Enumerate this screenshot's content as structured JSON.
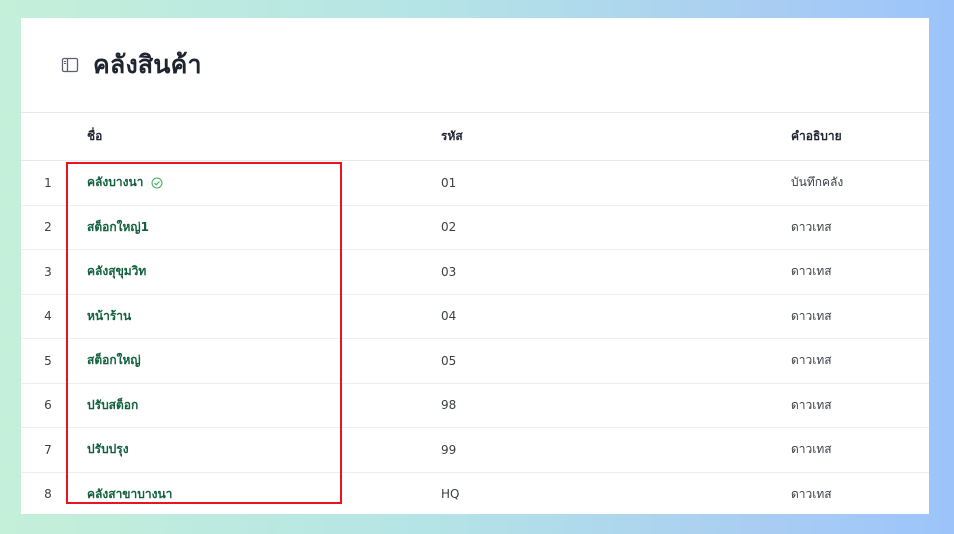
{
  "page": {
    "title": "คลังสินค้า",
    "title_icon": "sidebar-panel-icon"
  },
  "table": {
    "headers": {
      "name": "ชื่อ",
      "code": "รหัส",
      "description": "คำอธิบาย"
    },
    "rows": [
      {
        "index": "1",
        "name": "คลังบางนา",
        "code": "01",
        "description": "บันทึกคลัง",
        "verified": true
      },
      {
        "index": "2",
        "name": "สต็อกใหญ่1",
        "code": "02",
        "description": "ดาวเทส",
        "verified": false
      },
      {
        "index": "3",
        "name": "คลังสุขุมวิท",
        "code": "03",
        "description": "ดาวเทส",
        "verified": false
      },
      {
        "index": "4",
        "name": "หน้าร้าน",
        "code": "04",
        "description": "ดาวเทส",
        "verified": false
      },
      {
        "index": "5",
        "name": "สต็อกใหญ่",
        "code": "05",
        "description": "ดาวเทส",
        "verified": false
      },
      {
        "index": "6",
        "name": "ปรับสต็อก",
        "code": "98",
        "description": "ดาวเทส",
        "verified": false
      },
      {
        "index": "7",
        "name": "ปรับปรุง",
        "code": "99",
        "description": "ดาวเทส",
        "verified": false
      },
      {
        "index": "8",
        "name": "คลังสาขาบางนา",
        "code": "HQ",
        "description": "ดาวเทส",
        "verified": false
      }
    ]
  },
  "colors": {
    "name_link": "#11603d",
    "verified_icon": "#3fae5a",
    "highlight_border": "#e8141f"
  }
}
